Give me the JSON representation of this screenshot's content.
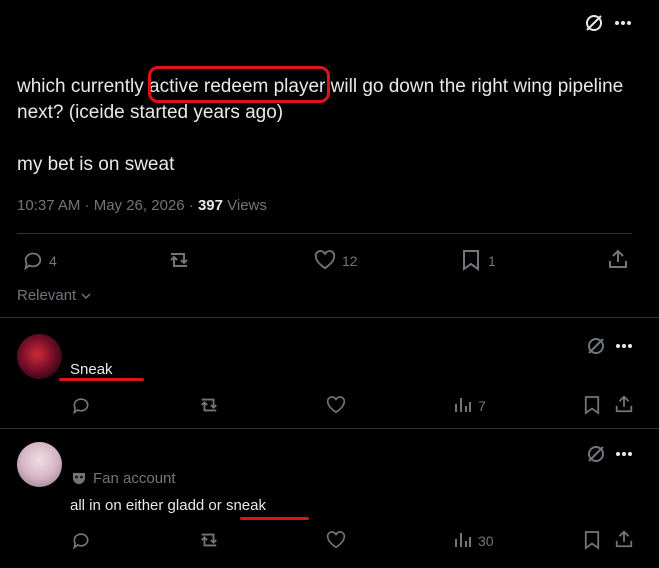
{
  "post": {
    "text_line1_before": "which currently ",
    "text_line1_highlight": "active redeem player",
    "text_line1_after": " will go down the right wing pipeline",
    "text_line2": "next? (iceide started years ago)",
    "text_line3": "my bet is on sweat",
    "timestamp": "10:37 AM · May 26, 2026 · ",
    "views_count": "397",
    "views_label": " Views",
    "reply_count": "4",
    "like_count": "12",
    "bookmark_count": "1"
  },
  "sort": {
    "label": "Relevant"
  },
  "replies": [
    {
      "text": "Sneak",
      "views": "7"
    },
    {
      "badge": "Fan account",
      "text_before": "all in on either gladd or ",
      "text_highlight": "sneak",
      "views": "30"
    }
  ],
  "colors": {
    "background": "#000000",
    "text": "#e7e9ea",
    "muted": "#71767b",
    "annotation_red": "#e0121c",
    "divider": "#2f3336"
  }
}
